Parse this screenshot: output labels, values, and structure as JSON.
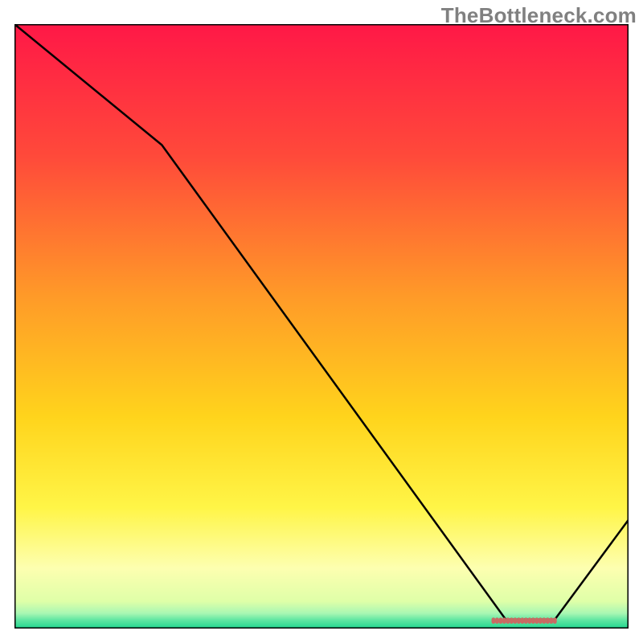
{
  "watermark": "TheBottleneck.com",
  "chart_data": {
    "type": "line",
    "title": "",
    "xlabel": "",
    "ylabel": "",
    "x": [
      0.0,
      0.24,
      0.8,
      0.88,
      1.0
    ],
    "y": [
      1.0,
      0.8,
      0.015,
      0.015,
      0.18
    ],
    "xlim": [
      0,
      1
    ],
    "ylim": [
      0,
      1
    ],
    "minimum_marker": {
      "x_start": 0.78,
      "x_end": 0.88,
      "y": 0.013
    },
    "background": {
      "type": "vertical-gradient",
      "stops": [
        {
          "pos": 0.0,
          "color": "#ff1847"
        },
        {
          "pos": 0.22,
          "color": "#ff4a3a"
        },
        {
          "pos": 0.45,
          "color": "#ff9a28"
        },
        {
          "pos": 0.65,
          "color": "#ffd41c"
        },
        {
          "pos": 0.8,
          "color": "#fff547"
        },
        {
          "pos": 0.9,
          "color": "#fdffb0"
        },
        {
          "pos": 0.955,
          "color": "#dfffa8"
        },
        {
          "pos": 0.975,
          "color": "#a8f7b3"
        },
        {
          "pos": 0.985,
          "color": "#65e7a3"
        },
        {
          "pos": 1.0,
          "color": "#1fd58f"
        }
      ]
    },
    "line_color": "#000000",
    "marker_color": "#c96a63"
  }
}
